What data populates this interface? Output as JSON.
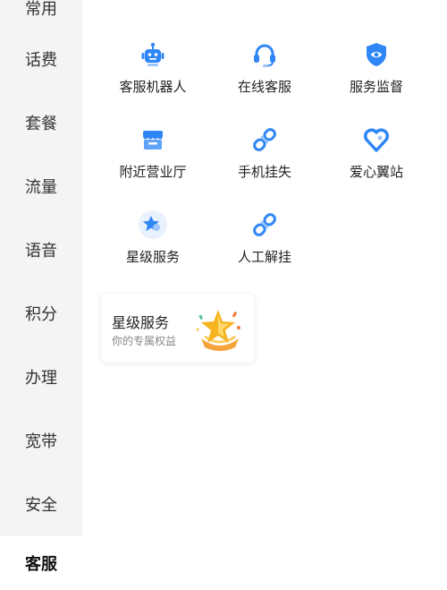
{
  "sidebar": {
    "items": [
      {
        "label": "常用"
      },
      {
        "label": "话费"
      },
      {
        "label": "套餐"
      },
      {
        "label": "流量"
      },
      {
        "label": "语音"
      },
      {
        "label": "积分"
      },
      {
        "label": "办理"
      },
      {
        "label": "宽带"
      },
      {
        "label": "安全"
      },
      {
        "label": "客服"
      }
    ]
  },
  "services": [
    {
      "label": "客服机器人",
      "icon": "robot-icon"
    },
    {
      "label": "在线客服",
      "icon": "headset-icon"
    },
    {
      "label": "服务监督",
      "icon": "shield-eye-icon"
    },
    {
      "label": "附近营业厅",
      "icon": "store-icon"
    },
    {
      "label": "手机挂失",
      "icon": "link-icon"
    },
    {
      "label": "爱心翼站",
      "icon": "heart-icon"
    },
    {
      "label": "星级服务",
      "icon": "star-badge-icon"
    },
    {
      "label": "人工解挂",
      "icon": "link-icon"
    }
  ],
  "vip_card": {
    "title": "星级服务",
    "subtitle": "你的专属权益",
    "icon": "star-trophy-icon"
  },
  "colors": {
    "accent": "#2f86f6",
    "sidebar_bg": "#f4f4f4",
    "star_gold": "#f6b421"
  }
}
